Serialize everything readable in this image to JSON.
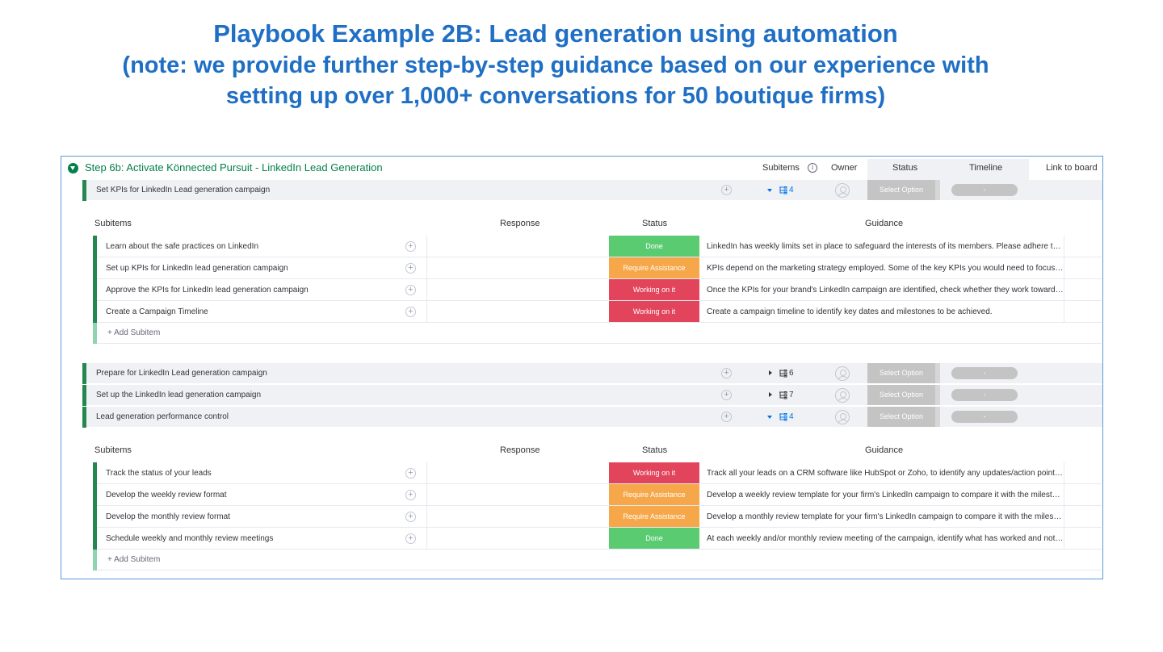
{
  "title": {
    "line1": "Playbook Example 2B: Lead generation using automation",
    "line2": "(note: we provide further step-by-step guidance based on our experience with",
    "line3": "setting up over 1,000+ conversations for 50 boutique firms)"
  },
  "colors": {
    "done": "#5bcb72",
    "require_assistance": "#f6a74a",
    "working_on_it": "#e2445c",
    "group": "#037f4c",
    "title": "#1f6fc5"
  },
  "group": {
    "title": "Step 6b: Activate Könnected Pursuit - LinkedIn Lead Generation",
    "columns": {
      "subitems": "Subitems",
      "owner": "Owner",
      "status": "Status",
      "timeline": "Timeline",
      "link": "Link to board"
    }
  },
  "item_defaults": {
    "select_option": "Select Option",
    "timeline_dash": "-",
    "add_subitem": "+ Add Subitem"
  },
  "sub_columns": {
    "subitems": "Subitems",
    "response": "Response",
    "status": "Status",
    "guidance": "Guidance"
  },
  "items": [
    {
      "name": "Set KPIs for LinkedIn Lead generation campaign",
      "subitem_count": "4",
      "expanded": true
    },
    {
      "name": "Prepare for LinkedIn Lead generation campaign",
      "subitem_count": "6",
      "expanded": false
    },
    {
      "name": "Set up the LinkedIn lead generation campaign",
      "subitem_count": "7",
      "expanded": false
    },
    {
      "name": "Lead generation performance control",
      "subitem_count": "4",
      "expanded": true
    }
  ],
  "subitems_a": [
    {
      "name": "Learn about the safe practices on LinkedIn",
      "status": "Done",
      "guidance": "LinkedIn has weekly limits set in place to safeguard the interests of its members. Please adhere to these limits."
    },
    {
      "name": "Set up KPIs for LinkedIn lead generation campaign",
      "status": "Require Assistance",
      "guidance": "KPIs depend on the marketing strategy employed. Some of the key KPIs you would need to focus first are listed."
    },
    {
      "name": "Approve the KPIs for LinkedIn lead generation campaign",
      "status": "Working on it",
      "guidance": "Once the KPIs for your brand's LinkedIn campaign are identified, check whether they work towards your goals."
    },
    {
      "name": "Create a Campaign Timeline",
      "status": "Working on it",
      "guidance": "Create a campaign timeline to identify key dates and milestones to be achieved."
    }
  ],
  "subitems_b": [
    {
      "name": "Track the status of your leads",
      "status": "Working on it",
      "guidance": "Track all your leads on a CRM software like HubSpot or Zoho, to identify any updates/action points needed."
    },
    {
      "name": "Develop the weekly review format",
      "status": "Require Assistance",
      "guidance": "Develop a weekly review template for your firm's LinkedIn campaign to compare it with the milestones set."
    },
    {
      "name": "Develop the monthly review format",
      "status": "Require Assistance",
      "guidance": "Develop a monthly review template for your firm's LinkedIn campaign to compare it with the milestones set."
    },
    {
      "name": "Schedule weekly and monthly review meetings",
      "status": "Done",
      "guidance": "At each weekly and/or monthly review meeting of the campaign, identify what has worked and not worked."
    }
  ]
}
